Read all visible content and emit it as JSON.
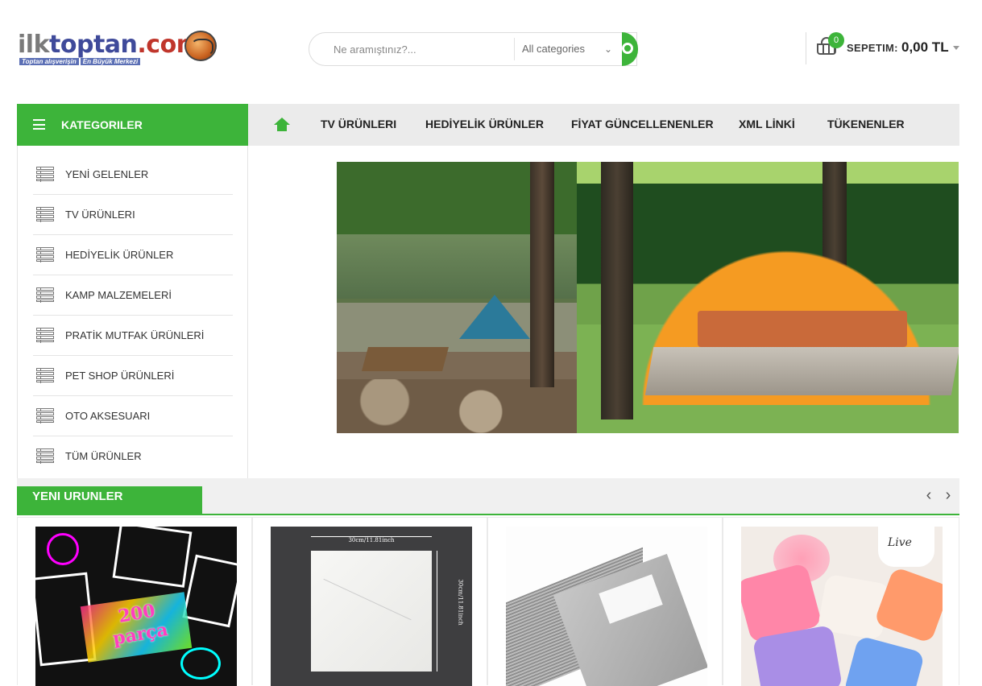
{
  "header": {
    "logo": {
      "word1": "ilk",
      "word2": "toptan",
      "word3": ".com",
      "tag1": "Toptan alışverişin",
      "tag2": "En Büyük Merkezi"
    },
    "search": {
      "placeholder": "Ne aramıştınız?...",
      "category": "All categories",
      "icon": "search-icon"
    },
    "cart": {
      "count": "0",
      "label": "SEPETIM:",
      "amount": "0,00 TL",
      "icon": "basket-icon"
    }
  },
  "nav": {
    "categories_label": "KATEGORILER",
    "items": [
      "TV ÜRÜNLERI",
      "HEDİYELİK ÜRÜNLER",
      "FİYAT GÜNCELLENENLER",
      "XML LİNKİ",
      "TÜKENENLER"
    ]
  },
  "sidebar": {
    "items": [
      "YENİ GELENLER",
      "TV ÜRÜNLERI",
      "HEDİYELİK ÜRÜNLER",
      "KAMP MALZEMELERİ",
      "PRATİK MUTFAK ÜRÜNLERİ",
      "PET SHOP ÜRÜNLERİ",
      "OTO AKSESUARI",
      "TÜM ÜRÜNLER"
    ]
  },
  "section": {
    "title": "YENI URUNLER",
    "prev": "‹",
    "next": "›"
  },
  "products": {
    "p1_text_line1": "200",
    "p1_text_line2": "parça",
    "p2_dim_top": "30cm/11.81inch",
    "p2_dim_side": "30cm/11.81inch",
    "p4_cup_text": "Live"
  },
  "colors": {
    "accent": "#3db43a",
    "nav_bg": "#ebebeb"
  }
}
